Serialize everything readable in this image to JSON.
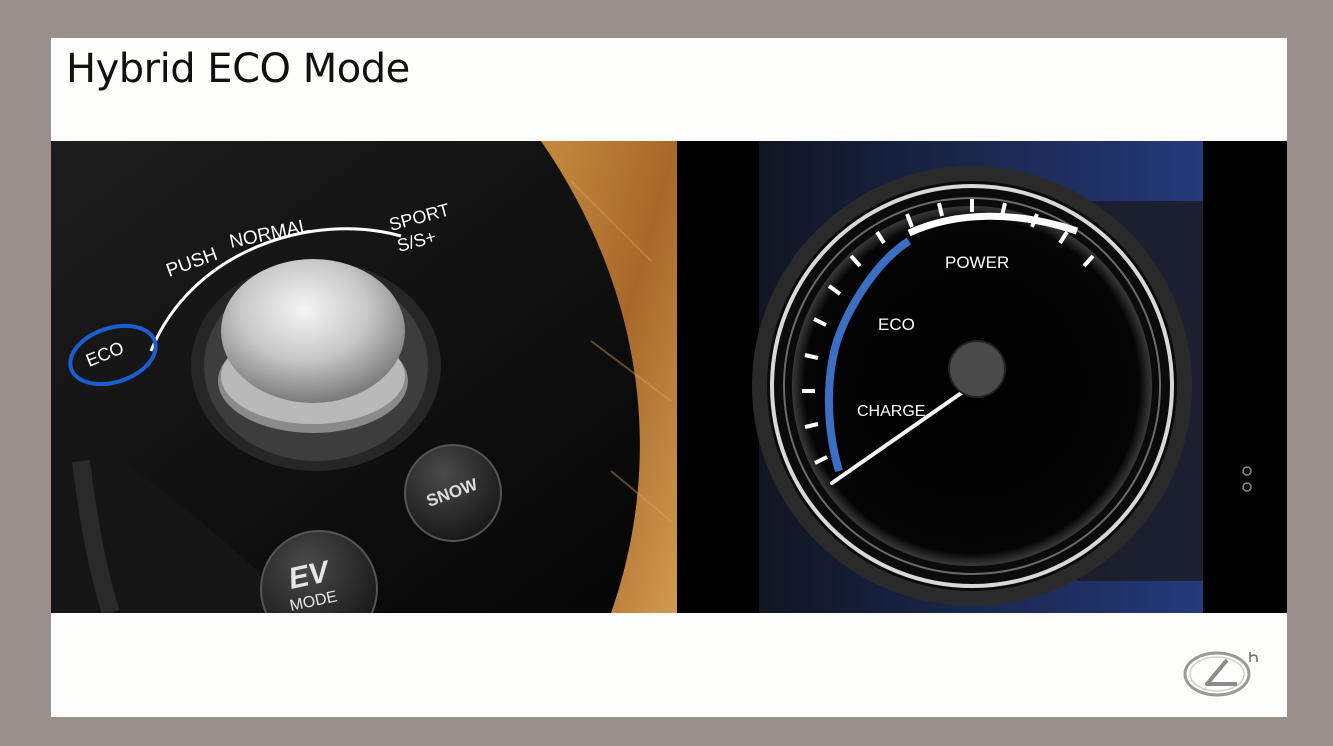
{
  "slide": {
    "title": "Hybrid ECO Mode"
  },
  "drive_mode_selector": {
    "labels": {
      "eco": "ECO",
      "push": "PUSH",
      "normal": "NORMAL",
      "sport": "SPORT",
      "sport_plus": "S/S+",
      "snow": "SNOW",
      "ev": "EV",
      "mode": "MODE"
    },
    "highlight_color": "#1a5fd1"
  },
  "hybrid_gauge": {
    "labels": {
      "power": "POWER",
      "eco": "ECO",
      "charge": "CHARGE"
    },
    "eco_arc_color": "#3a6fc4"
  },
  "colors": {
    "frame": "#9b8f8b",
    "slide_background": "#fdfdfb",
    "wood_trim": "#b07430"
  }
}
